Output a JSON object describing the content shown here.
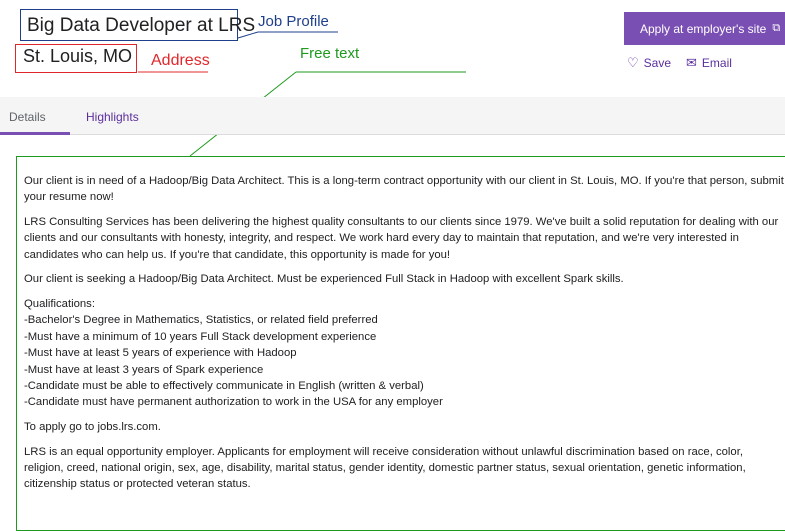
{
  "annotations": {
    "job_profile": "Job Profile",
    "address": "Address",
    "free_text": "Free text"
  },
  "job": {
    "title": "Big Data Developer at LRS",
    "location": "St. Louis, MO"
  },
  "actions": {
    "apply_label": "Apply at employer's site",
    "apply_icon": "external-link-icon",
    "save_label": "Save",
    "save_icon": "heart-icon",
    "email_label": "Email",
    "email_icon": "envelope-icon"
  },
  "tabs": [
    {
      "label": "Details",
      "active": true
    },
    {
      "label": "Highlights",
      "active": false
    }
  ],
  "description": {
    "p1": "Our client is in need of a Hadoop/Big Data Architect. This is a long-term contract opportunity with our client in St. Louis, MO. If you're that person, submit your resume now!",
    "p2": "LRS Consulting Services has been delivering the highest quality consultants to our clients since 1979. We've built a solid reputation for dealing with our clients and our consultants with honesty, integrity, and respect. We work hard every day to maintain that reputation, and we're very interested in candidates who can help us. If you're that candidate, this opportunity is made for you!",
    "p3": "Our client is seeking a Hadoop/Big Data Architect. Must be experienced Full Stack in Hadoop with excellent Spark skills.",
    "qualifications_heading": "Qualifications:",
    "qualifications": [
      "-Bachelor's Degree in Mathematics, Statistics, or related field preferred",
      "-Must have a minimum of 10 years Full Stack development experience",
      "-Must have at least 5 years of experience with Hadoop",
      "-Must have at least 3 years of Spark experience",
      "-Candidate must be able to effectively communicate in English (written & verbal)",
      "-Candidate must have permanent authorization to work in the USA for any employer"
    ],
    "p4": "To apply go to jobs.lrs.com.",
    "p5": "LRS is an equal opportunity employer. Applicants for employment will receive consideration without unlawful discrimination based on race, color, religion, creed, national origin, sex, age, disability, marital status, gender identity, domestic partner status, sexual orientation, genetic information, citizenship status or protected veteran status."
  },
  "colors": {
    "accent": "#7a4fb3",
    "job_profile_annotation": "#1f3f8c",
    "address_annotation": "#e0282c",
    "free_text_annotation": "#1e9a1e"
  }
}
